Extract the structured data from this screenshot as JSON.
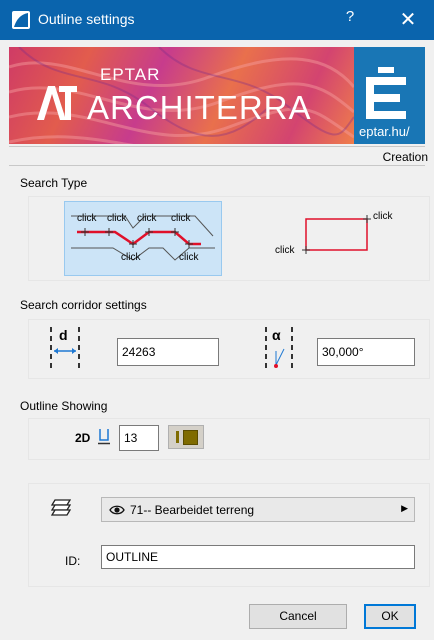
{
  "window": {
    "title": "Outline settings",
    "help_label": "?",
    "close_label": "✕"
  },
  "banner": {
    "eptar_text": "EPTAR",
    "architerra_text": "ARCHITERRA",
    "brand_url": "eptar.hu/"
  },
  "creation_label": "Creation",
  "search_type": {
    "label": "Search Type",
    "polyline_clicks": [
      "click",
      "click",
      "click",
      "click",
      "click",
      "click"
    ],
    "rect_clicks": [
      "click",
      "click"
    ],
    "selected": "polyline"
  },
  "corridor": {
    "label": "Search corridor settings",
    "distance_symbol": "d",
    "distance_value": "24263",
    "angle_symbol": "α",
    "angle_value": "30,000°"
  },
  "outline_showing": {
    "label": "Outline Showing",
    "mode_label": "2D",
    "pen_value": "13"
  },
  "layer": {
    "selected_layer": "71-- Bearbeidet terreng",
    "id_label": "ID:",
    "id_value": "OUTLINE"
  },
  "buttons": {
    "cancel_label": "Cancel",
    "ok_label": "OK"
  },
  "colors": {
    "titlebar": "#0a64ad",
    "accent": "#0078d7",
    "pen_fill": "#7f6b00",
    "polyline": "#e0102a"
  }
}
